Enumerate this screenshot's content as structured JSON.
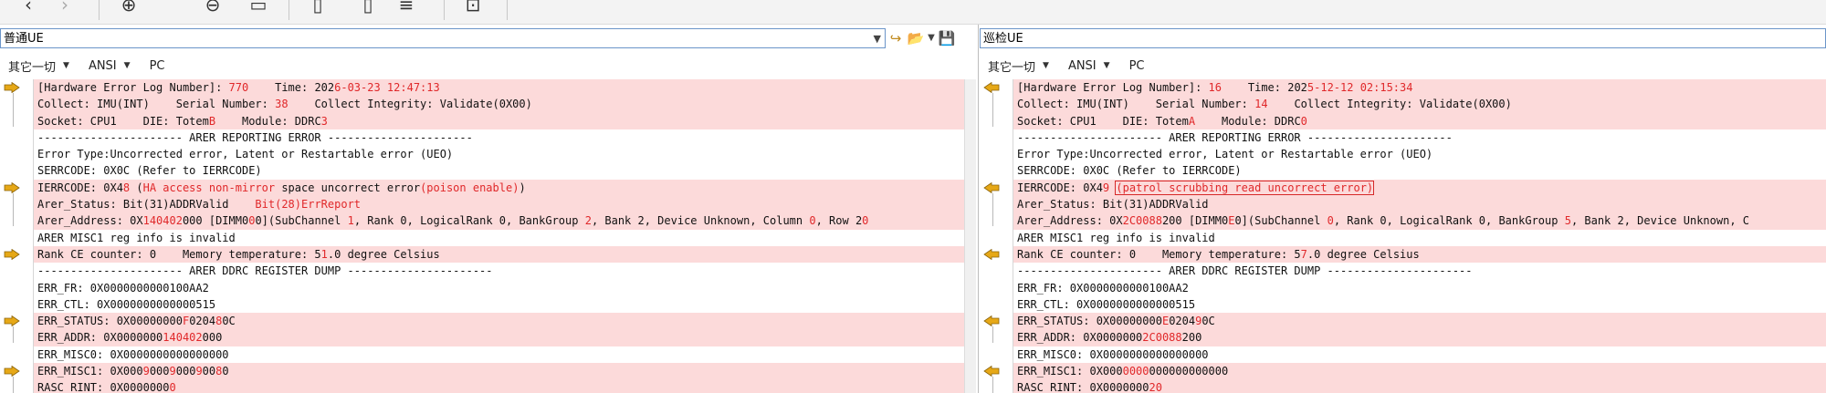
{
  "left": {
    "path": "普通UE",
    "options": [
      "其它一切",
      "ANSI",
      "PC"
    ],
    "lines": [
      {
        "diff": true,
        "arrow": true,
        "segs": [
          [
            "[Hardware Error Log Number]: ",
            0
          ],
          [
            "770",
            1
          ],
          [
            "    Time: 202",
            0
          ],
          [
            "6-03-23 12:47:13",
            1
          ]
        ]
      },
      {
        "diff": true,
        "segs": [
          [
            "Collect: IMU(INT)    Serial Number: ",
            0
          ],
          [
            "38",
            1
          ],
          [
            "    Collect Integrity: Validate(0X00)",
            0
          ]
        ]
      },
      {
        "diff": true,
        "segs": [
          [
            "Socket: CPU1    DIE: Totem",
            0
          ],
          [
            "B",
            1
          ],
          [
            "    Module: DDRC",
            0
          ],
          [
            "3",
            1
          ]
        ]
      },
      {
        "diff": false,
        "segs": [
          [
            "---------------------- ARER REPORTING ERROR ----------------------",
            0
          ]
        ]
      },
      {
        "diff": false,
        "segs": [
          [
            "Error Type:Uncorrected error, Latent or Restartable error (UEO)",
            0
          ]
        ]
      },
      {
        "diff": false,
        "segs": [
          [
            "SERRCODE: 0X0C (Refer to IERRCODE)",
            0
          ]
        ]
      },
      {
        "diff": true,
        "arrow": true,
        "segs": [
          [
            "IERRCODE: 0X4",
            0
          ],
          [
            "8",
            1
          ],
          [
            " (",
            0
          ],
          [
            "HA access non-mirror",
            1
          ],
          [
            " space uncorrect error",
            0
          ],
          [
            "(poison enable)",
            1
          ],
          [
            ")",
            0
          ]
        ]
      },
      {
        "diff": true,
        "segs": [
          [
            "Arer_Status: Bit(31)ADDRValid    ",
            0
          ],
          [
            "Bit(28)ErrReport",
            1
          ]
        ]
      },
      {
        "diff": true,
        "segs": [
          [
            "Arer_Address: 0X",
            0
          ],
          [
            "140402",
            1
          ],
          [
            "000 [DIMM0",
            0
          ],
          [
            "0",
            1
          ],
          [
            "0](SubChannel ",
            0
          ],
          [
            "1",
            1
          ],
          [
            ", Rank 0, LogicalRank 0, BankGroup ",
            0
          ],
          [
            "2",
            1
          ],
          [
            ", Bank 2, Device Unknown, Column ",
            0
          ],
          [
            "0",
            1
          ],
          [
            ", Row 2",
            0
          ],
          [
            "0",
            1
          ]
        ]
      },
      {
        "diff": false,
        "segs": [
          [
            "ARER MISC1 reg info is invalid",
            0
          ]
        ]
      },
      {
        "diff": true,
        "arrow": true,
        "segs": [
          [
            "Rank CE counter: 0    Memory temperature: 5",
            0
          ],
          [
            "1",
            1
          ],
          [
            ".0 degree Celsius",
            0
          ]
        ]
      },
      {
        "diff": false,
        "segs": [
          [
            "---------------------- ARER DDRC REGISTER DUMP ----------------------",
            0
          ]
        ]
      },
      {
        "diff": false,
        "segs": [
          [
            "ERR_FR: 0X0000000000100AA2",
            0
          ]
        ]
      },
      {
        "diff": false,
        "segs": [
          [
            "ERR_CTL: 0X0000000000000515",
            0
          ]
        ]
      },
      {
        "diff": true,
        "arrow": true,
        "segs": [
          [
            "ERR_STATUS: 0X00000000",
            0
          ],
          [
            "F",
            1
          ],
          [
            "0204",
            0
          ],
          [
            "8",
            1
          ],
          [
            "0C",
            0
          ]
        ]
      },
      {
        "diff": true,
        "segs": [
          [
            "ERR_ADDR: 0X0000000",
            0
          ],
          [
            "140402",
            1
          ],
          [
            "000",
            0
          ]
        ]
      },
      {
        "diff": false,
        "segs": [
          [
            "ERR_MISC0: 0X0000000000000000",
            0
          ]
        ]
      },
      {
        "diff": true,
        "arrow": true,
        "segs": [
          [
            "ERR_MISC1: 0X000",
            0
          ],
          [
            "9",
            1
          ],
          [
            "000",
            0
          ],
          [
            "9",
            1
          ],
          [
            "000",
            0
          ],
          [
            "9",
            1
          ],
          [
            "00",
            0
          ],
          [
            "8",
            1
          ],
          [
            "0",
            0
          ]
        ]
      },
      {
        "diff": true,
        "segs": [
          [
            "RASC_RINT: 0X0000000",
            0
          ],
          [
            "0",
            1
          ]
        ]
      }
    ]
  },
  "right": {
    "path": "巡检UE",
    "options": [
      "其它一切",
      "ANSI",
      "PC"
    ],
    "lines": [
      {
        "diff": true,
        "arrow": true,
        "segs": [
          [
            "[Hardware Error Log Number]: ",
            0
          ],
          [
            "16",
            1
          ],
          [
            "    Time: 202",
            0
          ],
          [
            "5-12-12 02:15:34",
            1
          ]
        ]
      },
      {
        "diff": true,
        "segs": [
          [
            "Collect: IMU(INT)    Serial Number: ",
            0
          ],
          [
            "14",
            1
          ],
          [
            "    Collect Integrity: Validate(0X00)",
            0
          ]
        ]
      },
      {
        "diff": true,
        "segs": [
          [
            "Socket: CPU1    DIE: Totem",
            0
          ],
          [
            "A",
            1
          ],
          [
            "    Module: DDRC",
            0
          ],
          [
            "0",
            1
          ]
        ]
      },
      {
        "diff": false,
        "segs": [
          [
            "---------------------- ARER REPORTING ERROR ----------------------",
            0
          ]
        ]
      },
      {
        "diff": false,
        "segs": [
          [
            "Error Type:Uncorrected error, Latent or Restartable error (UEO)",
            0
          ]
        ]
      },
      {
        "diff": false,
        "segs": [
          [
            "SERRCODE: 0X0C (Refer to IERRCODE)",
            0
          ]
        ]
      },
      {
        "diff": true,
        "arrow": true,
        "segs": [
          [
            "IERRCODE: 0X4",
            0
          ],
          [
            "9",
            1
          ],
          [
            " ",
            0
          ],
          [
            "(patrol scrubbing read uncorrect error)",
            2
          ]
        ]
      },
      {
        "diff": true,
        "segs": [
          [
            "Arer_Status: Bit(31)ADDRValid",
            0
          ]
        ]
      },
      {
        "diff": true,
        "segs": [
          [
            "Arer_Address: 0X",
            0
          ],
          [
            "2C0088",
            1
          ],
          [
            "200 [DIMM0",
            0
          ],
          [
            "E",
            1
          ],
          [
            "0](SubChannel ",
            0
          ],
          [
            "0",
            1
          ],
          [
            ", Rank 0, LogicalRank 0, BankGroup ",
            0
          ],
          [
            "5",
            1
          ],
          [
            ", Bank 2, Device Unknown, C",
            0
          ]
        ]
      },
      {
        "diff": false,
        "segs": [
          [
            "ARER MISC1 reg info is invalid",
            0
          ]
        ]
      },
      {
        "diff": true,
        "arrow": true,
        "segs": [
          [
            "Rank CE counter: 0    Memory temperature: 5",
            0
          ],
          [
            "7",
            1
          ],
          [
            ".0 degree Celsius",
            0
          ]
        ]
      },
      {
        "diff": false,
        "segs": [
          [
            "---------------------- ARER DDRC REGISTER DUMP ----------------------",
            0
          ]
        ]
      },
      {
        "diff": false,
        "segs": [
          [
            "ERR_FR: 0X0000000000100AA2",
            0
          ]
        ]
      },
      {
        "diff": false,
        "segs": [
          [
            "ERR_CTL: 0X0000000000000515",
            0
          ]
        ]
      },
      {
        "diff": true,
        "arrow": true,
        "segs": [
          [
            "ERR_STATUS: 0X00000000",
            0
          ],
          [
            "E",
            1
          ],
          [
            "0204",
            0
          ],
          [
            "9",
            1
          ],
          [
            "0C",
            0
          ]
        ]
      },
      {
        "diff": true,
        "segs": [
          [
            "ERR_ADDR: 0X0000000",
            0
          ],
          [
            "2C0088",
            1
          ],
          [
            "200",
            0
          ]
        ]
      },
      {
        "diff": false,
        "segs": [
          [
            "ERR_MISC0: 0X0000000000000000",
            0
          ]
        ]
      },
      {
        "diff": true,
        "arrow": true,
        "segs": [
          [
            "ERR_MISC1: 0X000",
            0
          ],
          [
            "0000",
            1
          ],
          [
            "000000000000",
            0
          ]
        ]
      },
      {
        "diff": true,
        "segs": [
          [
            "RASC_RINT: 0X0000000",
            0
          ],
          [
            "20",
            1
          ]
        ]
      }
    ]
  },
  "colors": {
    "diff_bg": "#fcdada",
    "highlight": "#e0282a",
    "arrow": "#e6a817"
  }
}
